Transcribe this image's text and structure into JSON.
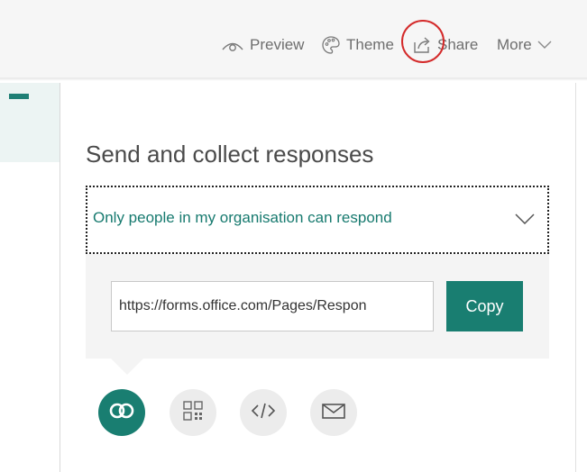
{
  "toolbar": {
    "preview_label": "Preview",
    "theme_label": "Theme",
    "share_label": "Share",
    "more_label": "More"
  },
  "share_panel": {
    "title": "Send and collect responses",
    "audience": {
      "selected": "Only people in my organisation can respond"
    },
    "link": {
      "value": "https://forms.office.com/Pages/Respon",
      "copy_label": "Copy"
    },
    "share_methods": [
      {
        "icon": "link-icon",
        "selected": true
      },
      {
        "icon": "qr-code-icon",
        "selected": false
      },
      {
        "icon": "embed-code-icon",
        "selected": false
      },
      {
        "icon": "email-icon",
        "selected": false
      }
    ]
  },
  "colors": {
    "accent": "#197e71",
    "accent_text": "#177a6f",
    "highlight_circle": "#d42b2b",
    "icon_button_bg": "#ececec",
    "link_area_bg": "#f4f4f4"
  }
}
